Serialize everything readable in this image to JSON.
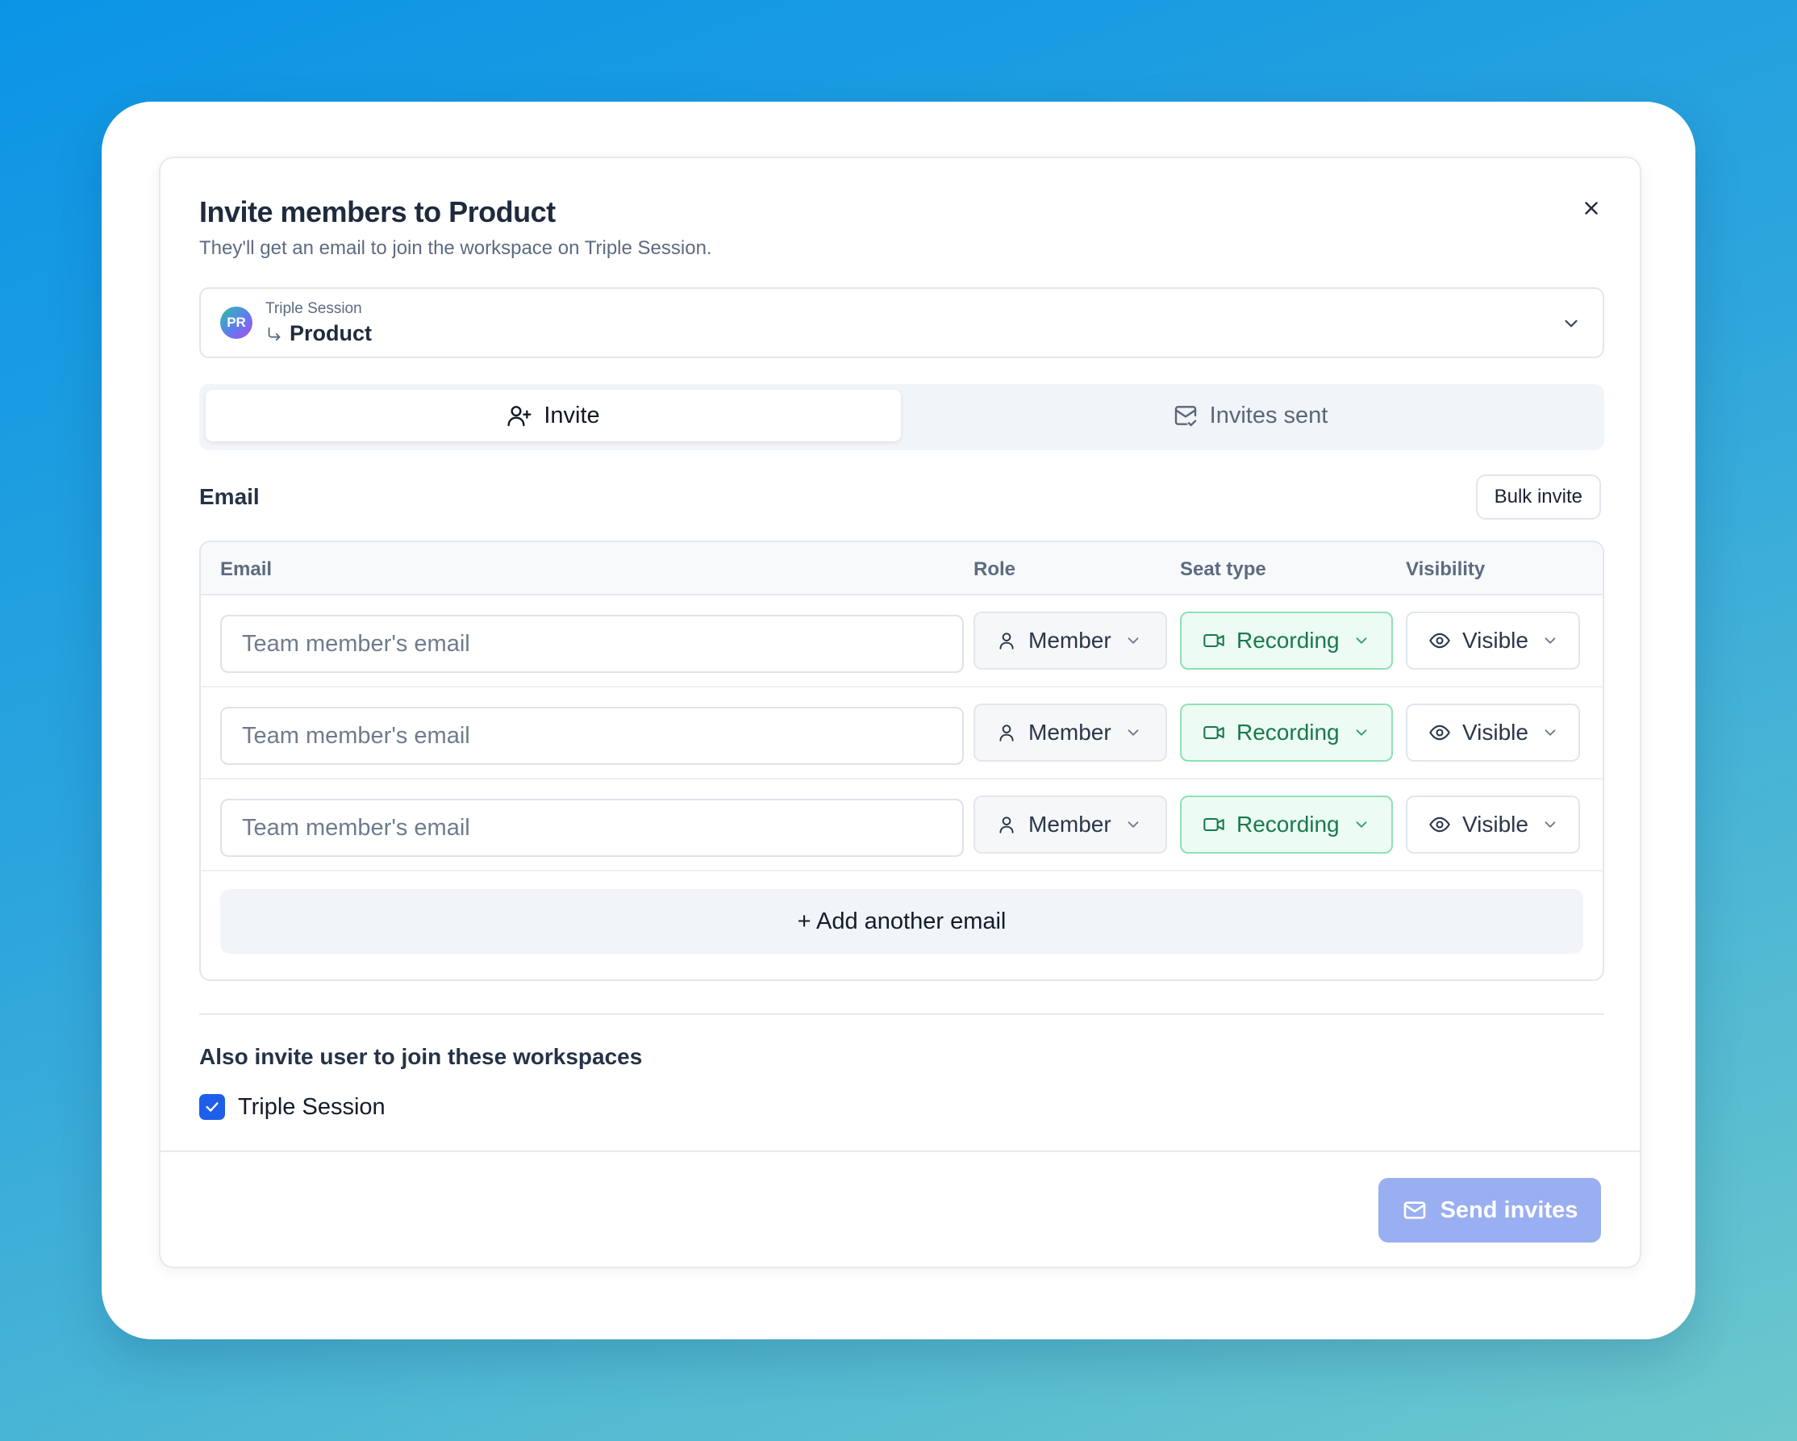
{
  "dialog": {
    "title": "Invite members to Product",
    "subtitle": "They'll get an email to join the workspace on Triple Session."
  },
  "workspace_selector": {
    "avatar_initials": "PR",
    "parent": "Triple Session",
    "child": "Product"
  },
  "tabs": [
    {
      "label": "Invite",
      "icon": "user-plus-icon",
      "active": true
    },
    {
      "label": "Invites sent",
      "icon": "mail-check-icon",
      "active": false
    }
  ],
  "email_section": {
    "label": "Email",
    "bulk_invite_label": "Bulk invite"
  },
  "table": {
    "headers": [
      "Email",
      "Role",
      "Seat type",
      "Visibility"
    ],
    "rows": [
      {
        "email_placeholder": "Team member's email",
        "email_value": "",
        "role": "Member",
        "seat_type": "Recording",
        "visibility": "Visible"
      },
      {
        "email_placeholder": "Team member's email",
        "email_value": "",
        "role": "Member",
        "seat_type": "Recording",
        "visibility": "Visible"
      },
      {
        "email_placeholder": "Team member's email",
        "email_value": "",
        "role": "Member",
        "seat_type": "Recording",
        "visibility": "Visible"
      }
    ],
    "add_another_label": "+ Add another email"
  },
  "also_invite": {
    "label": "Also invite user to join these workspaces",
    "workspaces": [
      {
        "name": "Triple Session",
        "checked": true
      }
    ]
  },
  "footer": {
    "send_label": "Send invites"
  },
  "colors": {
    "primary": "#1d5fe8",
    "send_disabled": "#9aaef2",
    "seat_text": "#177a4c",
    "seat_bg": "#ecfbf3"
  }
}
